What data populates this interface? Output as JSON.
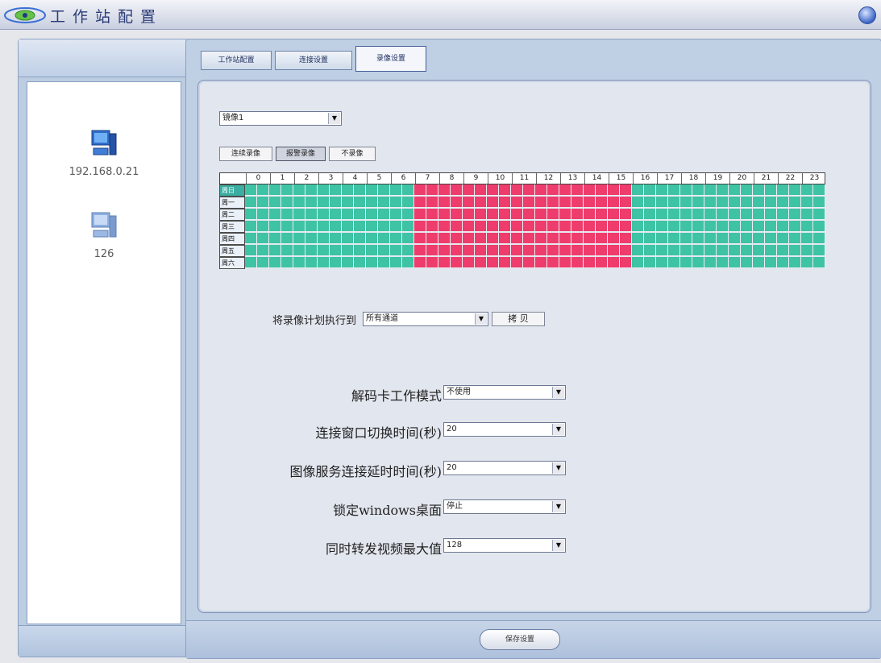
{
  "window": {
    "title": "工作站配置"
  },
  "sidebar": {
    "devices": [
      {
        "label": "192.168.0.21",
        "icon": "computer-icon",
        "color": "#2f6fc9"
      },
      {
        "label": "126",
        "icon": "computer-icon",
        "color": "#8fb0e0"
      }
    ]
  },
  "tabs": [
    {
      "label": "工作站配置",
      "active": false
    },
    {
      "label": "连接设置",
      "active": false
    },
    {
      "label": "录像设置",
      "active": true
    }
  ],
  "record": {
    "camera_select": "镜像1",
    "modes": [
      {
        "label": "连续录像",
        "pressed": false
      },
      {
        "label": "报警录像",
        "pressed": true
      },
      {
        "label": "不录像",
        "pressed": false
      }
    ],
    "hours": [
      "0",
      "1",
      "2",
      "3",
      "4",
      "5",
      "6",
      "7",
      "8",
      "9",
      "10",
      "11",
      "12",
      "13",
      "14",
      "15",
      "16",
      "17",
      "18",
      "19",
      "20",
      "21",
      "22",
      "23"
    ],
    "days": [
      "周日",
      "周一",
      "周二",
      "周三",
      "周四",
      "周五",
      "周六"
    ],
    "schedule_colors": {
      "continuous": "#3ec3a5",
      "alarm": "#ee3c6c"
    },
    "alarm_hours_range": [
      7,
      16
    ],
    "copy_label": "将录像计划执行到",
    "copy_target": "所有通道",
    "copy_button": "拷 贝"
  },
  "settings": [
    {
      "label": "解码卡工作模式",
      "value": "不使用"
    },
    {
      "label": "连接窗口切换时间(秒)",
      "value": "20"
    },
    {
      "label": "图像服务连接延时时间(秒)",
      "value": "20"
    },
    {
      "label": "锁定windows桌面",
      "value": "停止"
    },
    {
      "label": "同时转发视频最大值",
      "value": "128"
    }
  ],
  "footer": {
    "save_label": "保存设置"
  }
}
